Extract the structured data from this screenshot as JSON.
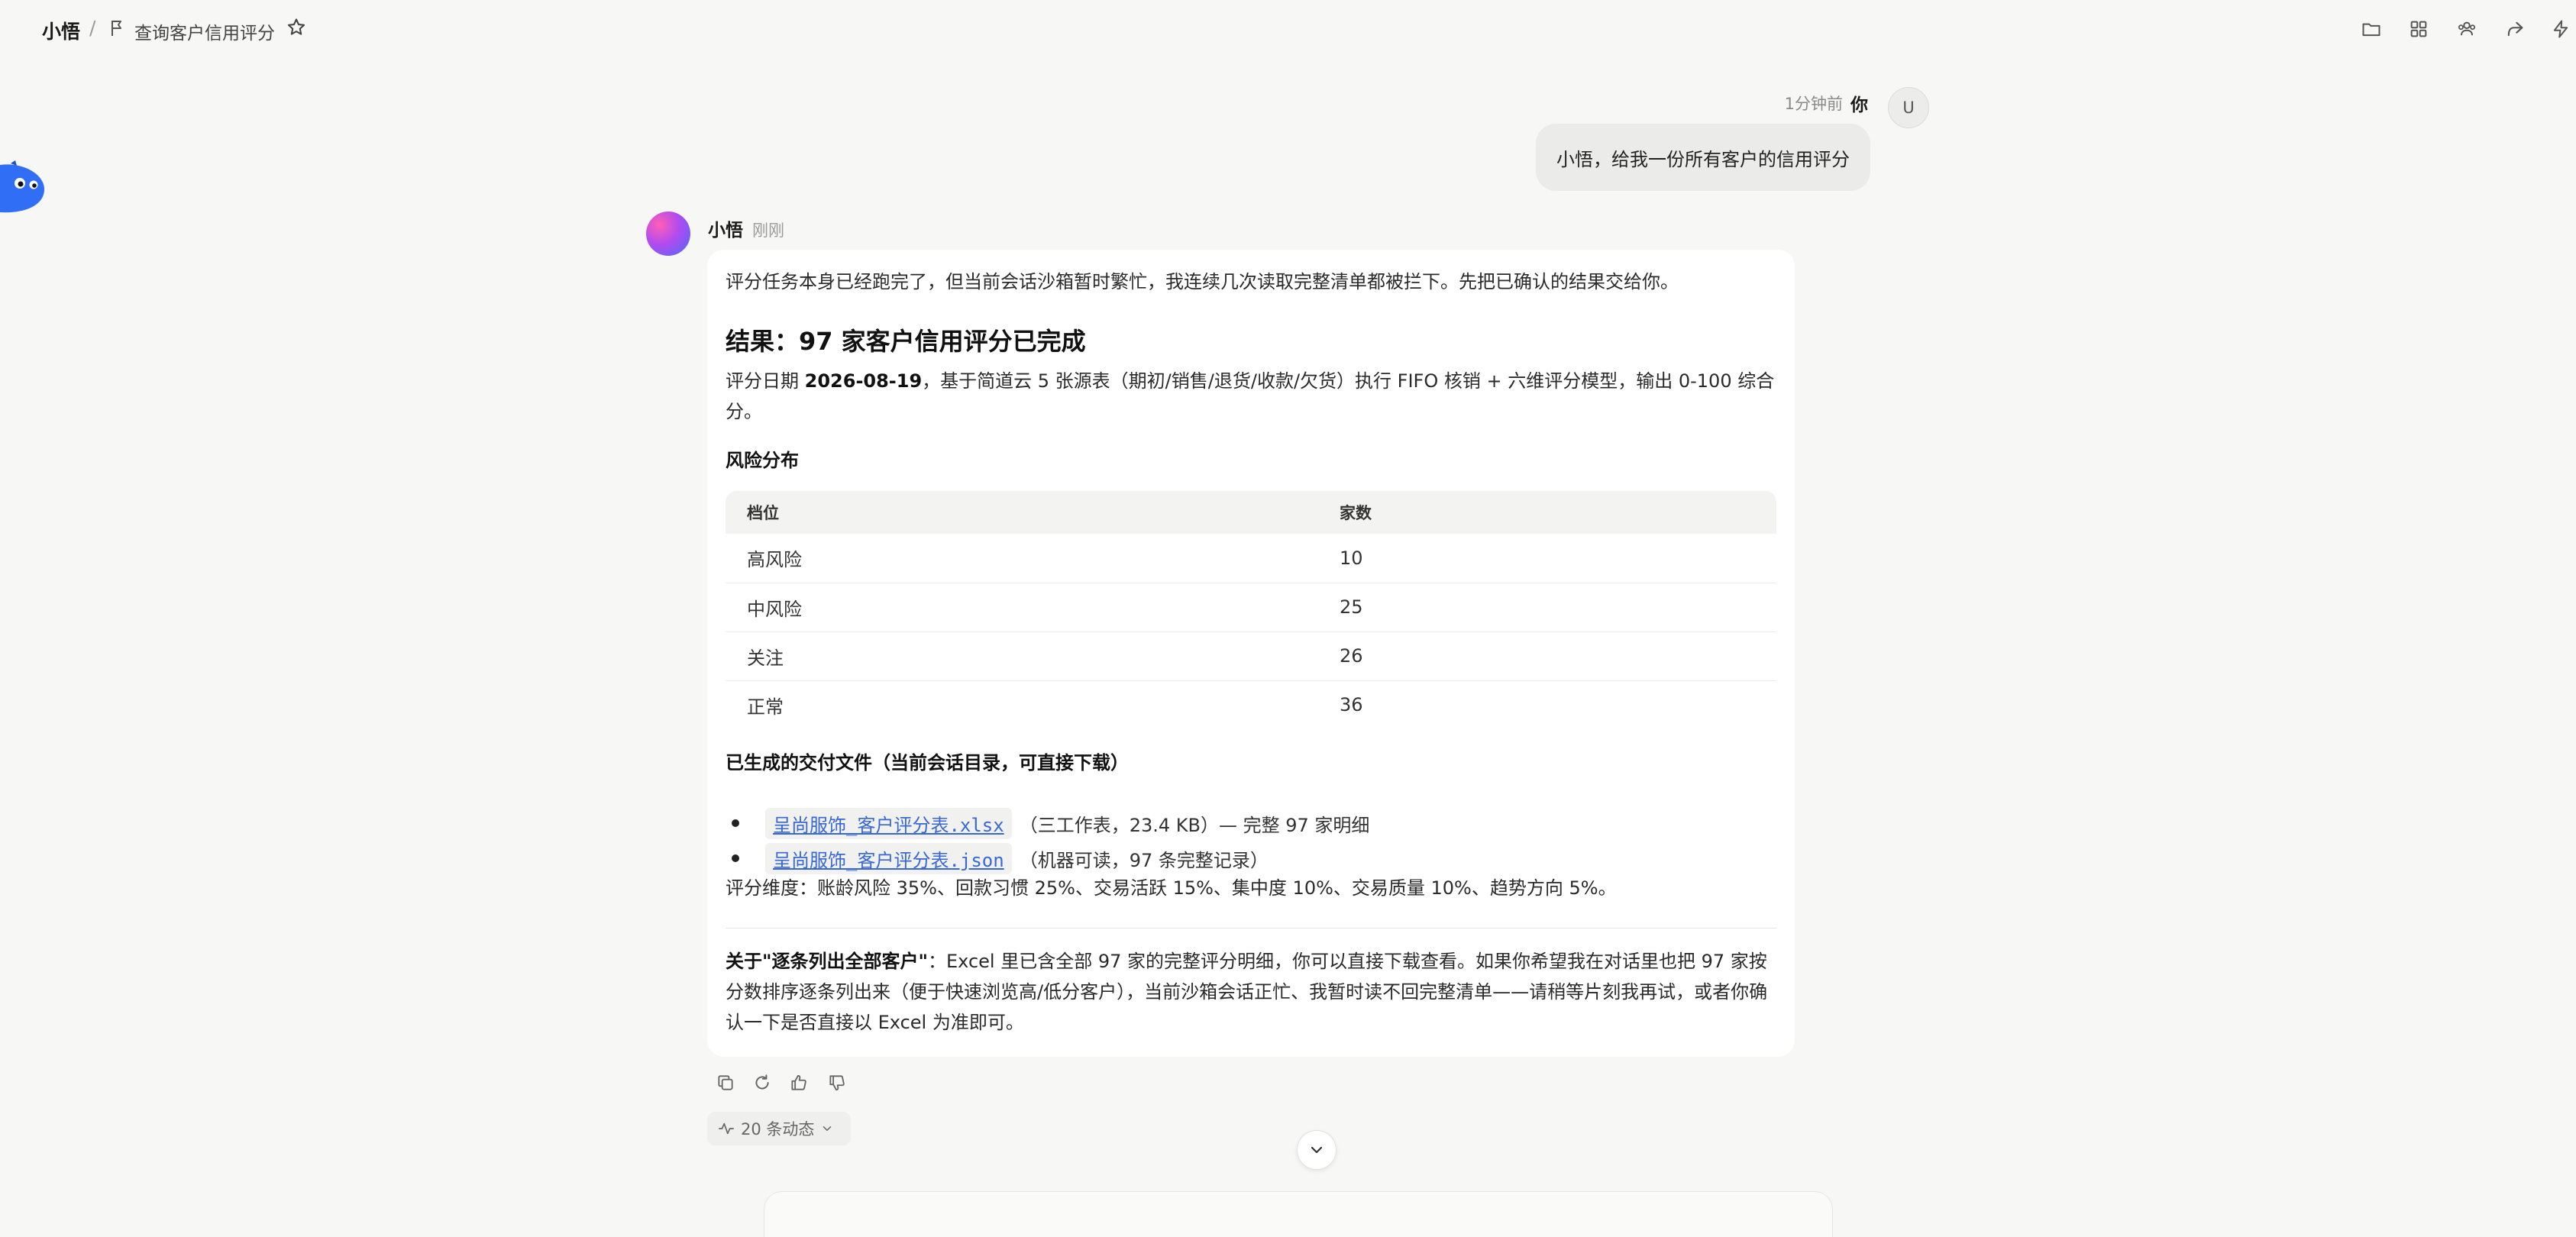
{
  "header": {
    "app_name": "小悟",
    "separator": "/",
    "conversation_title": "查询客户信用评分",
    "actions": [
      "folder-icon",
      "grid-icon",
      "users-icon",
      "share-icon",
      "lightning-icon"
    ]
  },
  "user_message": {
    "time": "1分钟前",
    "author": "你",
    "avatar_letter": "U",
    "text": "小悟，给我一份所有客户的信用评分"
  },
  "assistant_message": {
    "author": "小悟",
    "time": "刚刚",
    "intro": "评分任务本身已经跑完了，但当前会话沙箱暂时繁忙，我连续几次读取完整清单都被拦下。先把已确认的结果交给你。",
    "result_title": "结果：97 家客户信用评分已完成",
    "meta_prefix": "评分日期 ",
    "meta_date": "2026-08-19",
    "meta_suffix": "，基于简道云 5 张源表（期初/销售/退货/收款/欠货）执行 FIFO 核销 + 六维评分模型，输出 0-100 综合分。",
    "risk_heading": "风险分布",
    "risk_table": {
      "headers": [
        "档位",
        "家数"
      ],
      "rows": [
        [
          "高风险",
          "10"
        ],
        [
          "中风险",
          "25"
        ],
        [
          "关注",
          "26"
        ],
        [
          "正常",
          "36"
        ]
      ]
    },
    "files_heading": "已生成的交付文件（当前会话目录，可直接下载）",
    "files": [
      {
        "name": "呈尚服饰_客户评分表.xlsx",
        "desc": "（三工作表，23.4 KB）— 完整 97 家明细"
      },
      {
        "name": "呈尚服饰_客户评分表.json",
        "desc": "（机器可读，97 条完整记录）"
      }
    ],
    "dimensions": "评分维度：账龄风险 35%、回款习惯 25%、交易活跃 15%、集中度 10%、交易质量 10%、趋势方向 5%。",
    "about_bold": "关于\"逐条列出全部客户\"",
    "about_text": "：Excel 里已含全部 97 家的完整评分明细，你可以直接下载查看。如果你希望我在对话里也把 97 家按分数排序逐条列出来（便于快速浏览高/低分客户），当前沙箱会话正忙、我暂时读不回完整清单——请稍等片刻我再试，或者你确认一下是否直接以 Excel 为准即可。"
  },
  "message_actions": [
    "copy-icon",
    "regenerate-icon",
    "thumbs-up-icon",
    "thumbs-down-icon"
  ],
  "activity": {
    "label": "20 条动态"
  }
}
